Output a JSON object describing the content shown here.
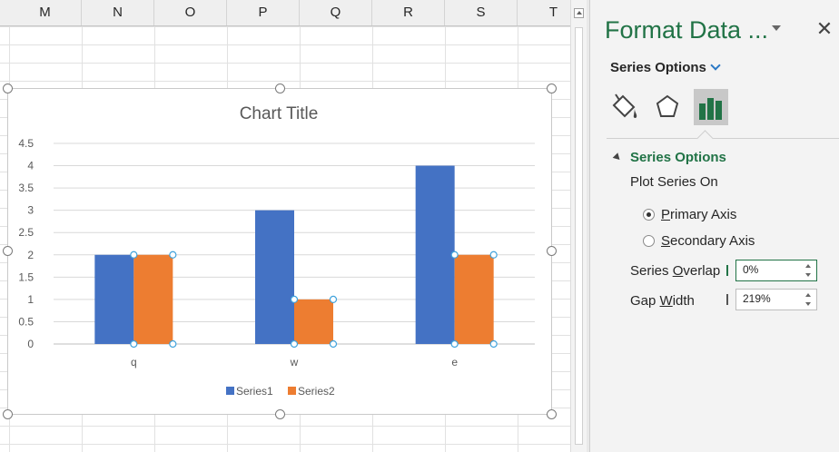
{
  "sheet": {
    "columns": [
      "M",
      "N",
      "O",
      "P",
      "Q",
      "R",
      "S",
      "T"
    ]
  },
  "chart_data": {
    "type": "bar",
    "title": "Chart Title",
    "categories": [
      "q",
      "w",
      "e"
    ],
    "series": [
      {
        "name": "Series1",
        "values": [
          2,
          3,
          4
        ],
        "color": "#4472c4"
      },
      {
        "name": "Series2",
        "values": [
          2,
          1,
          2
        ],
        "color": "#ed7d31"
      }
    ],
    "yticks": [
      "0",
      "0.5",
      "1",
      "1.5",
      "2",
      "2.5",
      "3",
      "3.5",
      "4",
      "4.5"
    ],
    "ylim": [
      0,
      4.5
    ],
    "grid": true,
    "legend": "bottom",
    "selected_series": "Series2"
  },
  "pane": {
    "title": "Format Data ...",
    "options_header": "Series Options",
    "section_title": "Series Options",
    "plot_series_on": "Plot Series On",
    "primary_axis": {
      "prefix": "",
      "key": "P",
      "rest": "rimary Axis",
      "checked": true
    },
    "secondary_axis": {
      "prefix": "",
      "key": "S",
      "rest": "econdary Axis",
      "checked": false
    },
    "series_overlap": {
      "prefix": "Series ",
      "key": "O",
      "rest": "verlap",
      "value": "0%"
    },
    "gap_width": {
      "prefix": "Gap ",
      "key": "W",
      "rest": "idth",
      "value": "219%"
    },
    "accent": "#217346",
    "tabs": [
      "fill-line",
      "effects",
      "series-options"
    ]
  }
}
